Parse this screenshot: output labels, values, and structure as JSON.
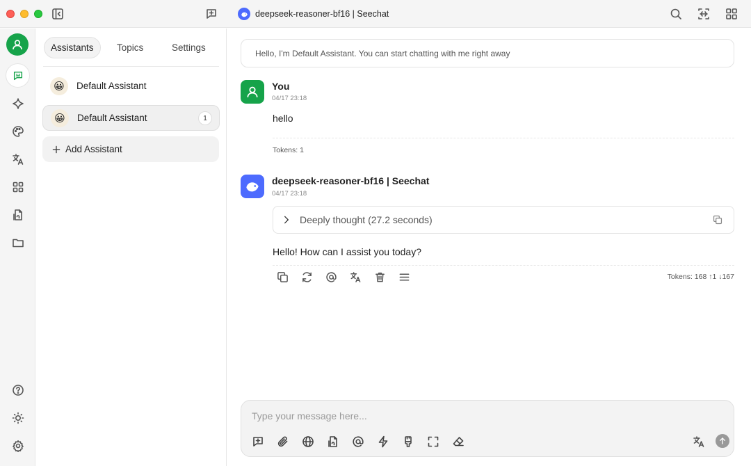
{
  "window": {
    "title": "deepseek-reasoner-bf16 | Seechat"
  },
  "panel": {
    "tabs": [
      {
        "label": "Assistants",
        "active": true
      },
      {
        "label": "Topics",
        "active": false
      },
      {
        "label": "Settings",
        "active": false
      }
    ],
    "assistants": [
      {
        "name": "Default Assistant",
        "emoji": "😀",
        "count": ""
      },
      {
        "name": "Default Assistant",
        "emoji": "😀",
        "count": "1"
      }
    ],
    "add_label": "Add Assistant"
  },
  "chat": {
    "prompt_notice": "Hello, I'm Default Assistant. You can start chatting with me right away",
    "messages": [
      {
        "sender": "You",
        "time": "04/17 23:18",
        "text": "hello",
        "tokens": "Tokens: 1"
      },
      {
        "sender": "deepseek-reasoner-bf16 | Seechat",
        "time": "04/17 23:18",
        "thought_label": "Deeply thought (27.2 seconds)",
        "text": "Hello! How can I assist you today?",
        "tokens": "Tokens: 168 ↑1 ↓167"
      }
    ],
    "composer": {
      "placeholder": "Type your message here..."
    }
  },
  "colors": {
    "user_avatar": "#16a34a",
    "model_logo": "#4d6bfe",
    "send_button": "#999999"
  }
}
